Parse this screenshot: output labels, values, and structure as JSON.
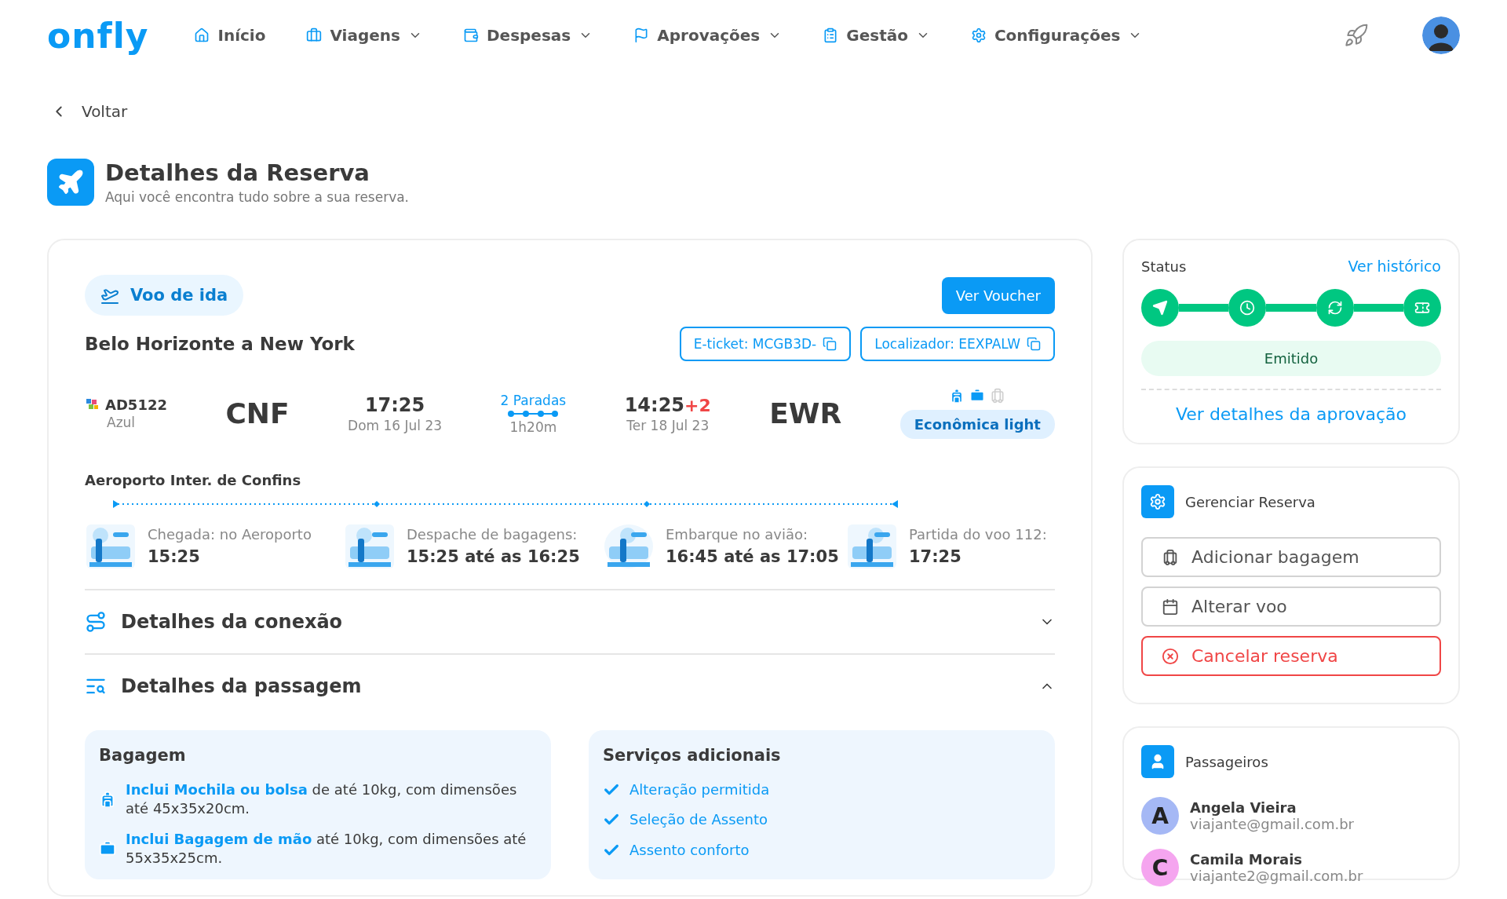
{
  "nav": {
    "logo": "onfly",
    "items": [
      {
        "label": "Início",
        "dropdown": false
      },
      {
        "label": "Viagens",
        "dropdown": true
      },
      {
        "label": "Despesas",
        "dropdown": true
      },
      {
        "label": "Aprovações",
        "dropdown": true
      },
      {
        "label": "Gestão",
        "dropdown": true
      },
      {
        "label": "Configurações",
        "dropdown": true
      }
    ]
  },
  "back": "Voltar",
  "header": {
    "title": "Detalhes da Reserva",
    "subtitle": "Aqui você encontra tudo sobre a sua reserva."
  },
  "flight": {
    "tag": "Voo de ida",
    "voucher_button": "Ver Voucher",
    "route": "Belo Horizonte a New York",
    "codes": [
      "E-ticket: MCGB3D-",
      "Localizador: EEXPALW"
    ],
    "flight_number": "AD5122",
    "airline": "Azul",
    "origin": "CNF",
    "departure_time": "17:25",
    "departure_date": "Dom 16 Jul 23",
    "stops": "2 Paradas",
    "duration": "1h20m",
    "arrival_time": "14:25",
    "day_offset": "+2",
    "arrival_date": "Ter 18 Jul 23",
    "destination": "EWR",
    "baggage": [
      {
        "kind": "backpack",
        "included": true
      },
      {
        "kind": "carry-on",
        "included": true
      },
      {
        "kind": "checked",
        "included": false
      }
    ],
    "fare_class": "Econômica light"
  },
  "airport": {
    "name": "Aeroporto Inter. de Confins",
    "steps": [
      {
        "label": "Chegada: no Aeroporto",
        "time": "15:25"
      },
      {
        "label": "Despache de bagagens:",
        "time": "15:25 até as 16:25"
      },
      {
        "label": "Embarque no avião:",
        "time": "16:45 até as 17:05"
      },
      {
        "label": "Partida do voo 112:",
        "time": "17:25"
      }
    ]
  },
  "sections": [
    {
      "title": "Detalhes da conexão",
      "expanded": false
    },
    {
      "title": "Detalhes da passagem",
      "expanded": true
    }
  ],
  "baggage_panel": {
    "title": "Bagagem",
    "items": [
      "**Inclui Mochila ou bolsa** de até 10kg, com dimensões até 45x35x20cm.",
      "**Inclui Bagagem de mão** até 10kg, com dimensões até 55x35x25cm."
    ]
  },
  "services_panel": {
    "title": "Serviços adicionais",
    "items": [
      "Alteração permitida",
      "Seleção de Assento",
      "Assento conforto"
    ]
  },
  "status": {
    "title": "Status",
    "history_link": "Ver histórico",
    "steps": [
      {
        "done": true
      },
      {
        "done": true
      },
      {
        "done": true
      },
      {
        "done": true
      }
    ],
    "label": "Emitido",
    "approval_link": "Ver detalhes da aprovação"
  },
  "manage": {
    "title": "Gerenciar Reserva",
    "actions": [
      {
        "label": "Adicionar bagagem",
        "kind": "default"
      },
      {
        "label": "Alterar voo",
        "kind": "default"
      },
      {
        "label": "Cancelar reserva",
        "kind": "danger"
      }
    ]
  },
  "passengers": {
    "title": "Passageiros",
    "list": [
      {
        "initial": "A",
        "name": "Angela Vieira",
        "email": "viajante@gmail.com.br",
        "color": "#a5b8f5"
      },
      {
        "initial": "C",
        "name": "Camila Morais",
        "email": "viajante2@gmail.com.br",
        "color": "#f5a5ef"
      }
    ]
  }
}
